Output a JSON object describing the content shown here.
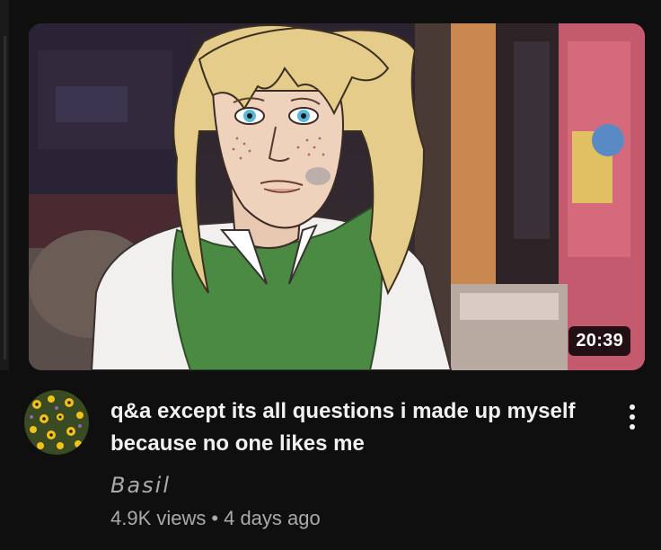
{
  "video": {
    "duration": "20:39",
    "title": "q&a except its all questions i made up myself because no one likes me",
    "channel": "Basil",
    "views": "4.9K views",
    "separator": "•",
    "age": "4 days ago"
  },
  "icons": {
    "menu": "more-vert-icon",
    "avatar": "channel-avatar-flowers"
  },
  "colors": {
    "background": "#0f0f0f",
    "title": "#f1f1f1",
    "secondary_text": "#aaaaaa"
  }
}
